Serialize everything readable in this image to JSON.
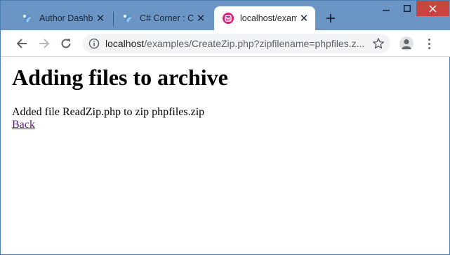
{
  "tabs": [
    {
      "label": "Author Dashboa",
      "favicon": "csharp-corner-favicon",
      "state": "inactive"
    },
    {
      "label": "C# Corner : Co",
      "favicon": "csharp-corner-favicon",
      "state": "inactive"
    },
    {
      "label": "localhost/exam",
      "favicon": "wamp-favicon",
      "state": "active"
    }
  ],
  "window_controls": {
    "minimize": "minimize-icon",
    "maximize": "maximize-icon",
    "close": "close-icon"
  },
  "address_bar": {
    "url_host": "localhost",
    "url_rest": "/examples/CreateZip.php?zipfilename=phpfiles.z..."
  },
  "page": {
    "heading": "Adding files to archive",
    "message": "Added file ReadZip.php to zip phpfiles.zip",
    "back_link": "Back"
  },
  "colors": {
    "titlebar": "#6b95c5",
    "close_button": "#c7453c",
    "link_visited": "#551a8b",
    "wamp_icon": "#e0197d"
  }
}
